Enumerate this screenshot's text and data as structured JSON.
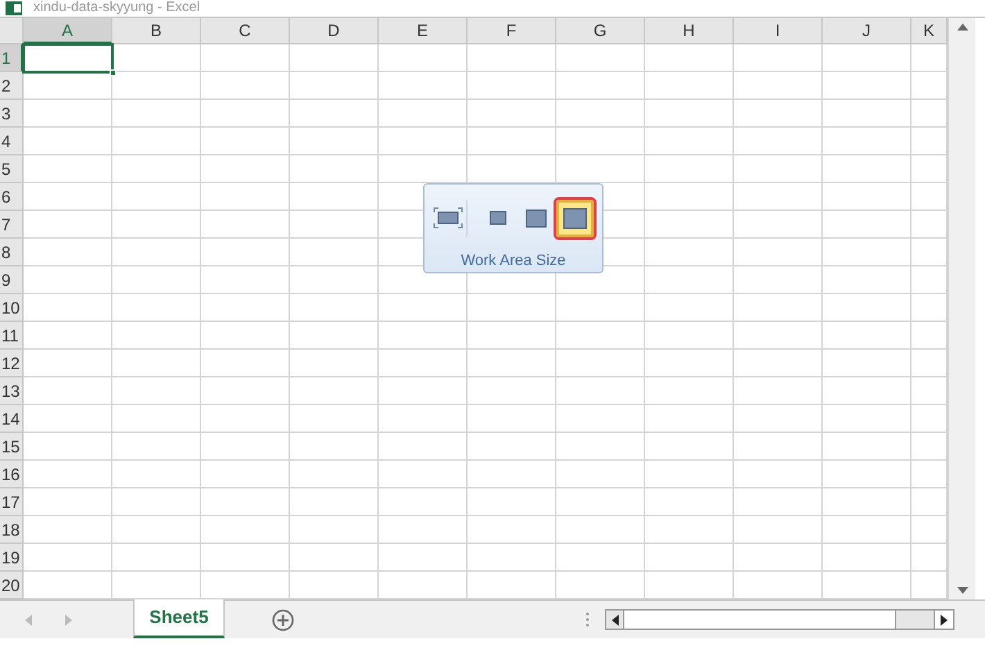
{
  "window": {
    "title": "xindu-data-skyyung - Excel"
  },
  "columns": [
    {
      "label": "A",
      "selected": true
    },
    {
      "label": "B",
      "selected": false
    },
    {
      "label": "C",
      "selected": false
    },
    {
      "label": "D",
      "selected": false
    },
    {
      "label": "E",
      "selected": false
    },
    {
      "label": "F",
      "selected": false
    },
    {
      "label": "G",
      "selected": false
    },
    {
      "label": "H",
      "selected": false
    },
    {
      "label": "I",
      "selected": false
    },
    {
      "label": "J",
      "selected": false
    },
    {
      "label": "K",
      "selected": false
    }
  ],
  "rows": [
    {
      "label": "1",
      "selected": true
    },
    {
      "label": "2",
      "selected": false
    },
    {
      "label": "3",
      "selected": false
    },
    {
      "label": "4",
      "selected": false
    },
    {
      "label": "5",
      "selected": false
    },
    {
      "label": "6",
      "selected": false
    },
    {
      "label": "7",
      "selected": false
    },
    {
      "label": "8",
      "selected": false
    },
    {
      "label": "9",
      "selected": false
    },
    {
      "label": "10",
      "selected": false
    },
    {
      "label": "11",
      "selected": false
    },
    {
      "label": "12",
      "selected": false
    },
    {
      "label": "13",
      "selected": false
    },
    {
      "label": "14",
      "selected": false
    },
    {
      "label": "15",
      "selected": false
    },
    {
      "label": "16",
      "selected": false
    },
    {
      "label": "17",
      "selected": false
    },
    {
      "label": "18",
      "selected": false
    },
    {
      "label": "19",
      "selected": false
    },
    {
      "label": "20",
      "selected": false
    }
  ],
  "popup": {
    "title": "Work Area Size",
    "options": [
      {
        "kind": "fit",
        "selected": false
      },
      {
        "kind": "small",
        "selected": false
      },
      {
        "kind": "medium",
        "selected": false
      },
      {
        "kind": "large",
        "selected": true
      }
    ]
  },
  "sheet_tabs": [
    {
      "label": "Sheet5",
      "selected": true
    }
  ]
}
